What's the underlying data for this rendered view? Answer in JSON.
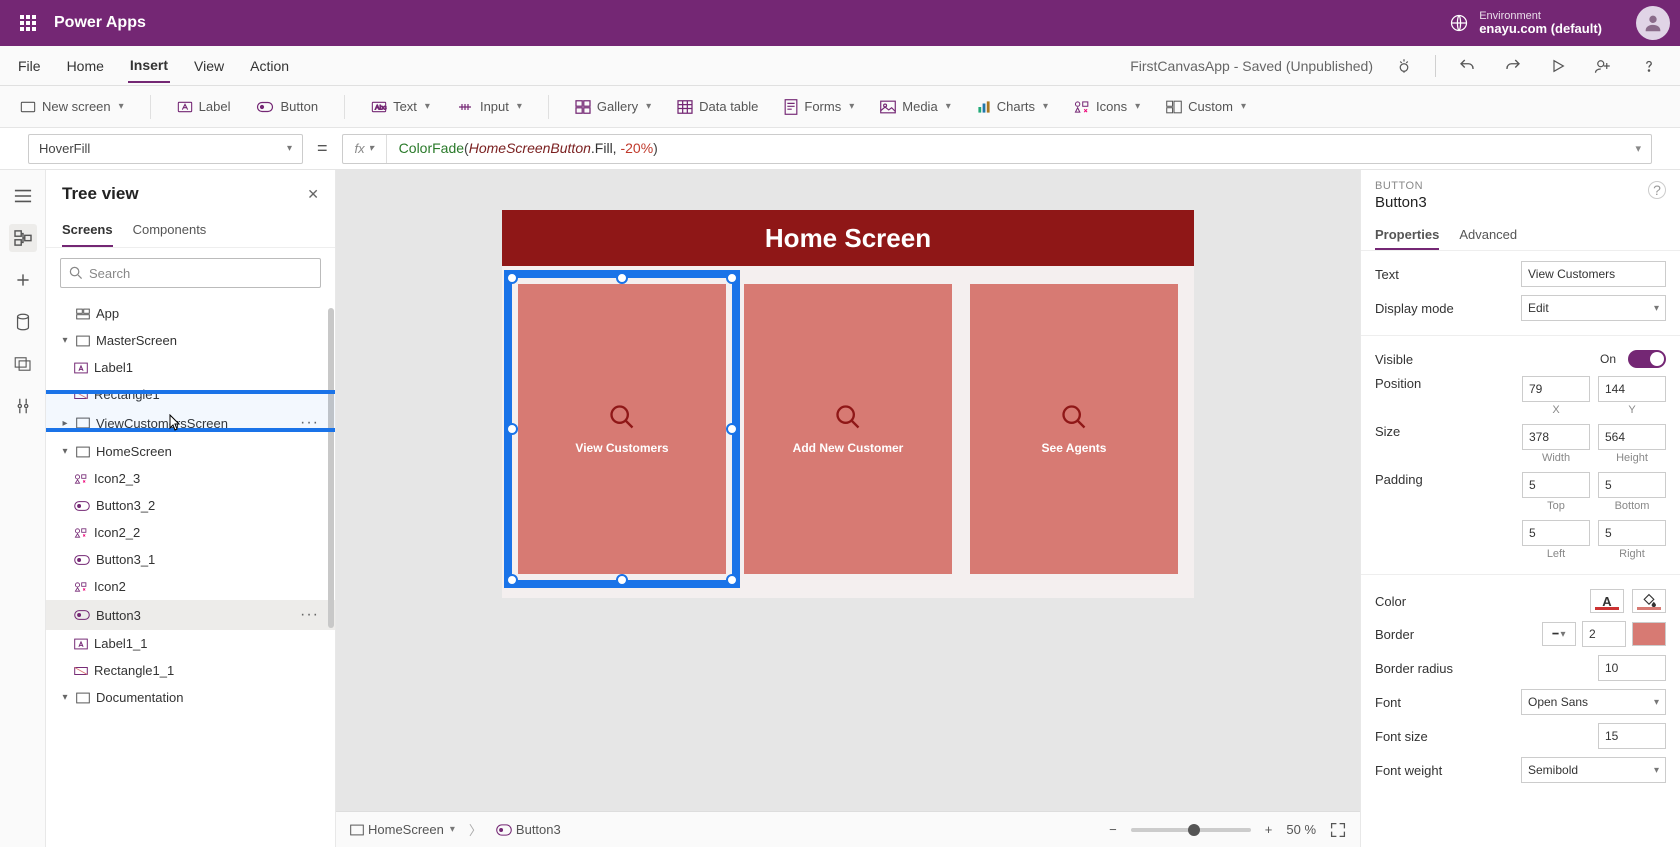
{
  "header": {
    "app_title": "Power Apps",
    "env_label": "Environment",
    "env_value": "enayu.com (default)"
  },
  "menubar": {
    "items": [
      "File",
      "Home",
      "Insert",
      "View",
      "Action"
    ],
    "active_index": 2,
    "doc_status": "FirstCanvasApp - Saved (Unpublished)"
  },
  "ribbon": {
    "new_screen": "New screen",
    "label": "Label",
    "button": "Button",
    "text": "Text",
    "input": "Input",
    "gallery": "Gallery",
    "data_table": "Data table",
    "forms": "Forms",
    "media": "Media",
    "charts": "Charts",
    "icons": "Icons",
    "custom": "Custom"
  },
  "formula_bar": {
    "property": "HoverFill",
    "fx_label": "fx",
    "formula_parts": {
      "fn": "ColorFade",
      "obj": "HomeScreenButton",
      "prop": ".Fill, ",
      "num": "-20%",
      "open": "(",
      "close": ")"
    }
  },
  "tree_panel": {
    "title": "Tree view",
    "tabs": [
      "Screens",
      "Components"
    ],
    "active_tab": 0,
    "search_placeholder": "Search",
    "nodes": [
      {
        "label": "App",
        "depth": 0
      },
      {
        "label": "MasterScreen",
        "depth": 0,
        "expander": "v"
      },
      {
        "label": "Label1",
        "depth": 1
      },
      {
        "label": "Rectangle1",
        "depth": 1
      },
      {
        "label": "ViewCustomersScreen",
        "depth": 0,
        "expander": ">",
        "highlighted": true,
        "ellipsis": true
      },
      {
        "label": "HomeScreen",
        "depth": 0,
        "expander": "v"
      },
      {
        "label": "Icon2_3",
        "depth": 1
      },
      {
        "label": "Button3_2",
        "depth": 1
      },
      {
        "label": "Icon2_2",
        "depth": 1
      },
      {
        "label": "Button3_1",
        "depth": 1
      },
      {
        "label": "Icon2",
        "depth": 1
      },
      {
        "label": "Button3",
        "depth": 1,
        "selected": true,
        "ellipsis": true
      },
      {
        "label": "Label1_1",
        "depth": 1
      },
      {
        "label": "Rectangle1_1",
        "depth": 1
      },
      {
        "label": "Documentation",
        "depth": 0,
        "expander": "v"
      }
    ]
  },
  "canvas": {
    "header_text": "Home Screen",
    "cards": [
      {
        "label": "View Customers"
      },
      {
        "label": "Add New Customer"
      },
      {
        "label": "See Agents"
      }
    ]
  },
  "status_bar": {
    "breadcrumb_screen": "HomeScreen",
    "breadcrumb_item": "Button3",
    "zoom_value": "50",
    "zoom_suffix": "%"
  },
  "properties_panel": {
    "type": "BUTTON",
    "name": "Button3",
    "tabs": [
      "Properties",
      "Advanced"
    ],
    "active_tab": 0,
    "text_label": "Text",
    "text_value": "View Customers",
    "display_mode_label": "Display mode",
    "display_mode_value": "Edit",
    "visible_label": "Visible",
    "visible_value": "On",
    "position_label": "Position",
    "position_x": "79",
    "position_y": "144",
    "position_x_lbl": "X",
    "position_y_lbl": "Y",
    "size_label": "Size",
    "size_w": "378",
    "size_h": "564",
    "size_w_lbl": "Width",
    "size_h_lbl": "Height",
    "padding_label": "Padding",
    "pad_top": "5",
    "pad_bottom": "5",
    "pad_left": "5",
    "pad_right": "5",
    "pad_top_lbl": "Top",
    "pad_bottom_lbl": "Bottom",
    "pad_left_lbl": "Left",
    "pad_right_lbl": "Right",
    "color_label": "Color",
    "border_label": "Border",
    "border_width": "2",
    "border_radius_label": "Border radius",
    "border_radius": "10",
    "font_label": "Font",
    "font_value": "Open Sans",
    "font_size_label": "Font size",
    "font_size": "15",
    "font_weight_label": "Font weight",
    "font_weight": "Semibold"
  }
}
